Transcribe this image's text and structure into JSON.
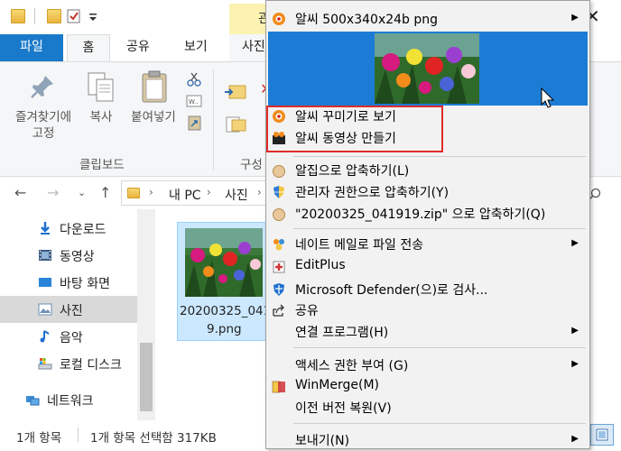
{
  "window": {
    "picture_tools_label": "관",
    "close_label": "✕"
  },
  "ribbon_tabs": {
    "file": "파일",
    "home": "홈",
    "share": "공유",
    "view": "보기",
    "manage": "사진"
  },
  "ribbon": {
    "pin_label_1": "즐겨찾기에",
    "pin_label_2": "고정",
    "copy_label": "복사",
    "paste_label": "붙여넣기",
    "clipboard_group": "클립보드",
    "organize_group": "구성"
  },
  "address": {
    "crumbs": [
      "내 PC",
      "사진"
    ]
  },
  "nav_pane": {
    "items": [
      {
        "label": "다운로드",
        "icon": "download-arrow-icon"
      },
      {
        "label": "동영상",
        "icon": "film-icon"
      },
      {
        "label": "바탕 화면",
        "icon": "desktop-icon"
      },
      {
        "label": "사진",
        "icon": "pictures-icon"
      },
      {
        "label": "음악",
        "icon": "music-note-icon"
      },
      {
        "label": "로컬 디스크",
        "icon": "drive-icon"
      },
      {
        "label": "네트워크",
        "icon": "network-icon"
      }
    ]
  },
  "file": {
    "name_line1": "20200325_041",
    "name_line2": "9.png"
  },
  "status": {
    "count": "1개 항목",
    "selection": "1개 항목 선택함 317KB"
  },
  "context_menu": {
    "header": "알씨 500x340x24b png",
    "items": [
      {
        "label": "알씨 꾸미기로 보기",
        "icon": "alsee-icon"
      },
      {
        "label": "알씨 동영상 만들기",
        "icon": "alsee-movie-icon"
      },
      {
        "label": "알집으로 압축하기(L)",
        "icon": "alzip-icon"
      },
      {
        "label": "관리자 권한으로 압축하기(Y)",
        "icon": "shield-icon"
      },
      {
        "label": "\"20200325_041919.zip\" 으로 압축하기(Q)",
        "icon": "alzip-icon"
      },
      {
        "label": "네이트 메일로 파일 전송",
        "icon": "nate-icon"
      },
      {
        "label": "EditPlus",
        "icon": "editplus-icon"
      },
      {
        "label": "Microsoft Defender(으)로 검사...",
        "icon": "defender-icon"
      },
      {
        "label": "공유",
        "icon": "share-icon"
      },
      {
        "label": "연결 프로그램(H)",
        "icon": ""
      },
      {
        "label": "액세스 권한 부여 (G)",
        "icon": ""
      },
      {
        "label": "WinMerge(M)",
        "icon": "winmerge-icon"
      },
      {
        "label": "이전 버전 복원(V)",
        "icon": ""
      },
      {
        "label": "보내기(N)",
        "icon": ""
      }
    ]
  }
}
